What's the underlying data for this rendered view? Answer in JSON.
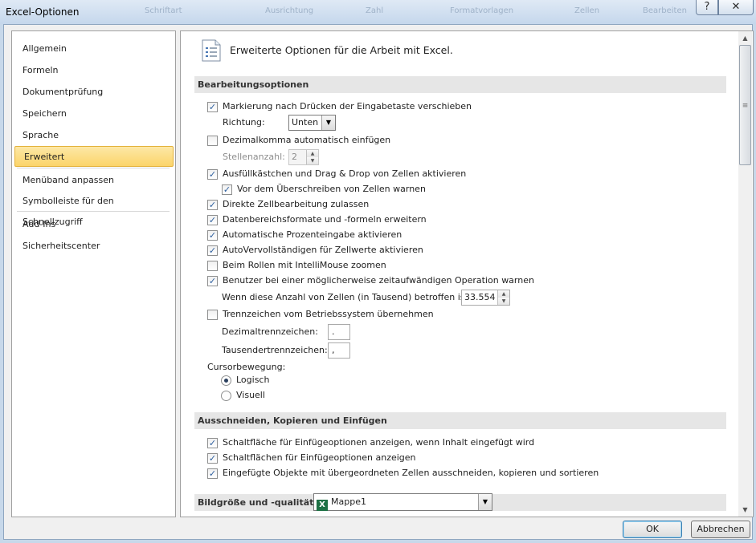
{
  "window": {
    "title": "Excel-Optionen",
    "ghost_tabs": [
      "Schriftart",
      "Ausrichtung",
      "Zahl",
      "Formatvorlagen",
      "Zellen",
      "Bearbeiten"
    ]
  },
  "nav": {
    "items": [
      {
        "label": "Allgemein"
      },
      {
        "label": "Formeln"
      },
      {
        "label": "Dokumentprüfung"
      },
      {
        "label": "Speichern"
      },
      {
        "label": "Sprache"
      },
      {
        "label": "Erweitert"
      },
      {
        "label": "Menüband anpassen"
      },
      {
        "label": "Symbolleiste für den Schnellzugriff"
      },
      {
        "label": "Add-Ins"
      },
      {
        "label": "Sicherheitscenter"
      }
    ],
    "selected": "Erweitert"
  },
  "header": {
    "title": "Erweiterte Optionen für die Arbeit mit Excel."
  },
  "sections": {
    "editing": "Bearbeitungsoptionen",
    "clipboard": "Ausschneiden, Kopieren und Einfügen",
    "image": "Bildgröße und -qualität"
  },
  "editing": {
    "move_selection": {
      "label": "Markierung nach Drücken der Eingabetaste verschieben",
      "checked": true
    },
    "direction": {
      "label": "Richtung:",
      "value": "Unten"
    },
    "auto_decimal": {
      "label": "Dezimalkomma automatisch einfügen",
      "checked": false
    },
    "places": {
      "label": "Stellenanzahl:",
      "value": "2"
    },
    "fill_handle": {
      "label": "Ausfüllkästchen und Drag & Drop von Zellen aktivieren",
      "checked": true
    },
    "alert_overwrite": {
      "label": "Vor dem Überschreiben von Zellen warnen",
      "checked": true
    },
    "edit_in_cell": {
      "label": "Direkte Zellbearbeitung zulassen",
      "checked": true
    },
    "extend_formats": {
      "label": "Datenbereichsformate und -formeln erweitern",
      "checked": true
    },
    "auto_percent": {
      "label": "Automatische Prozenteingabe aktivieren",
      "checked": true
    },
    "autocomplete": {
      "label": "AutoVervollständigen für Zellwerte aktivieren",
      "checked": true
    },
    "intellimouse_zoom": {
      "label": "Beim Rollen mit IntelliMouse zoomen",
      "checked": false
    },
    "alert_slow": {
      "label": "Benutzer bei einer möglicherweise zeitaufwändigen Operation warnen",
      "checked": true
    },
    "cells_threshold": {
      "label": "Wenn diese Anzahl von Zellen (in Tausend) betroffen ist:",
      "value": "33.554"
    },
    "system_separators": {
      "label": "Trennzeichen vom Betriebssystem übernehmen",
      "checked": false
    },
    "decimal_sep": {
      "label": "Dezimaltrennzeichen:",
      "value": "."
    },
    "thousands_sep": {
      "label": "Tausendertrennzeichen:",
      "value": ","
    },
    "cursor_movement": {
      "label": "Cursorbewegung:",
      "options": [
        {
          "label": "Logisch",
          "selected": true
        },
        {
          "label": "Visuell",
          "selected": false
        }
      ]
    }
  },
  "clipboard": {
    "paste_options_button": {
      "label": "Schaltfläche für Einfügeoptionen anzeigen, wenn Inhalt eingefügt wird",
      "checked": true
    },
    "insert_options_buttons": {
      "label": "Schaltflächen für Einfügeoptionen anzeigen",
      "checked": true
    },
    "cut_copy_sort_objects": {
      "label": "Eingefügte Objekte mit übergeordneten Zellen ausschneiden, kopieren und sortieren",
      "checked": true
    }
  },
  "image": {
    "workbook": "Mappe1"
  },
  "buttons": {
    "ok": "OK",
    "cancel": "Abbrechen"
  },
  "icons": {
    "check": "✓",
    "dropdown": "▼",
    "up": "▲",
    "down": "▼",
    "grip": "≡",
    "help": "?",
    "close": "✕"
  }
}
